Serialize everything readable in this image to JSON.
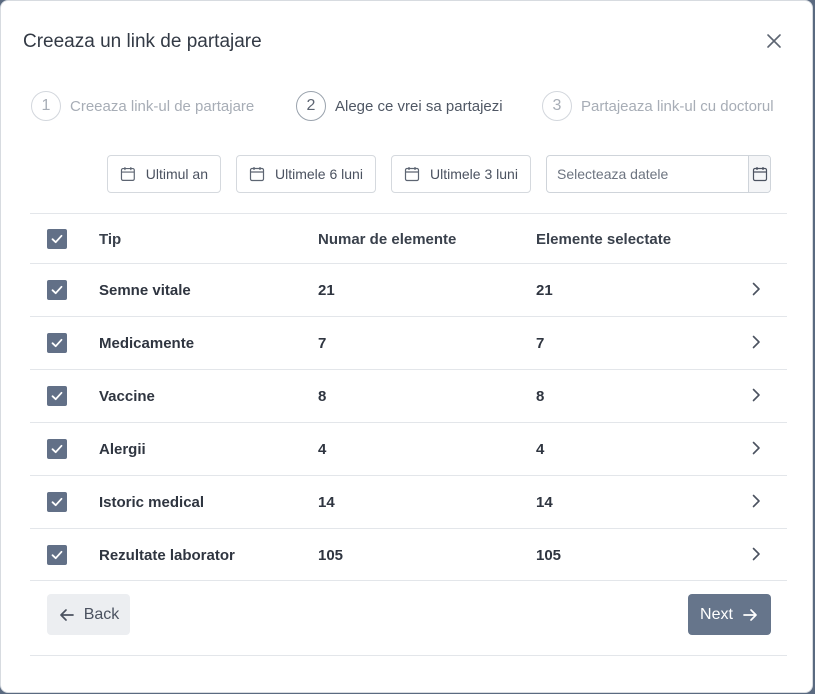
{
  "dialog": {
    "title": "Creeaza un link de partajare"
  },
  "steps": [
    {
      "number": "1",
      "label": "Creeaza link-ul de partajare"
    },
    {
      "number": "2",
      "label": "Alege ce vrei sa partajezi"
    },
    {
      "number": "3",
      "label": "Partajeaza link-ul cu doctorul"
    }
  ],
  "filters": {
    "last_year": "Ultimul an",
    "last_6_months": "Ultimele 6 luni",
    "last_3_months": "Ultimele 3 luni",
    "date_placeholder": "Selecteaza datele"
  },
  "table": {
    "columns": [
      "Tip",
      "Numar de elemente",
      "Elemente selectate"
    ],
    "rows": [
      {
        "type": "Semne vitale",
        "count": "21",
        "selected": "21",
        "checked": true
      },
      {
        "type": "Medicamente",
        "count": "7",
        "selected": "7",
        "checked": true
      },
      {
        "type": "Vaccine",
        "count": "8",
        "selected": "8",
        "checked": true
      },
      {
        "type": "Alergii",
        "count": "4",
        "selected": "4",
        "checked": true
      },
      {
        "type": "Istoric medical",
        "count": "14",
        "selected": "14",
        "checked": true
      },
      {
        "type": "Rezultate laborator",
        "count": "105",
        "selected": "105",
        "checked": true
      }
    ]
  },
  "footer": {
    "back_label": "Back",
    "next_label": "Next"
  },
  "colors": {
    "accent": "#66758b",
    "checkbox": "#627087"
  },
  "icons": [
    "close-icon",
    "calendar-icon",
    "check-icon",
    "chevron-right-icon",
    "arrow-left-icon",
    "arrow-right-icon"
  ]
}
